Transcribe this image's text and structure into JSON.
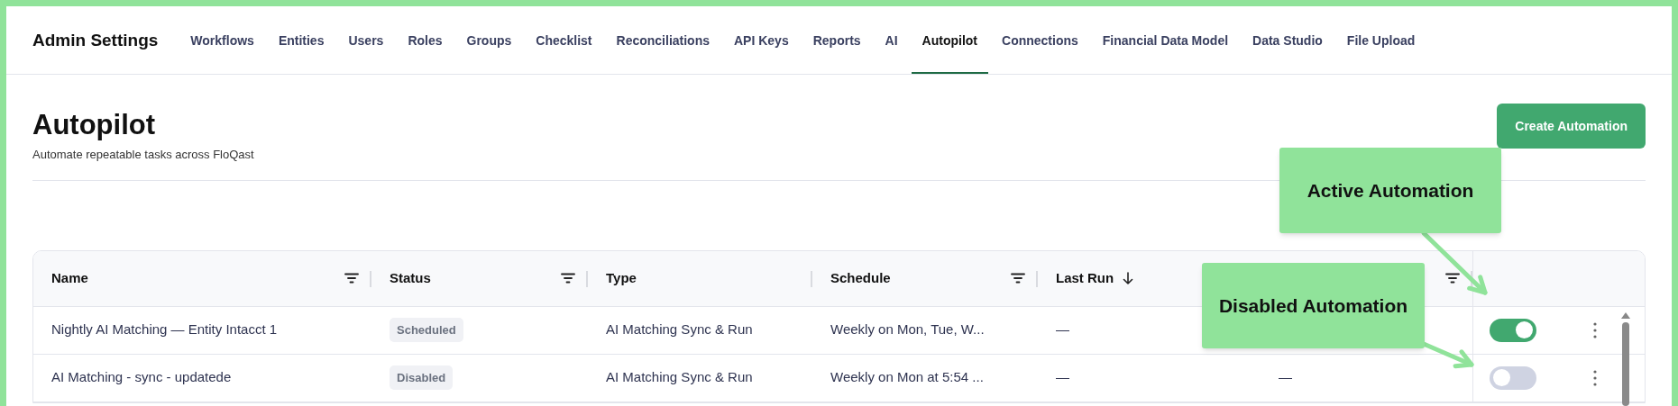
{
  "nav": {
    "title": "Admin Settings",
    "tabs": [
      {
        "label": "Workflows",
        "selected": false
      },
      {
        "label": "Entities",
        "selected": false
      },
      {
        "label": "Users",
        "selected": false
      },
      {
        "label": "Roles",
        "selected": false
      },
      {
        "label": "Groups",
        "selected": false
      },
      {
        "label": "Checklist",
        "selected": false
      },
      {
        "label": "Reconciliations",
        "selected": false
      },
      {
        "label": "API Keys",
        "selected": false
      },
      {
        "label": "Reports",
        "selected": false
      },
      {
        "label": "AI",
        "selected": false
      },
      {
        "label": "Autopilot",
        "selected": true
      },
      {
        "label": "Connections",
        "selected": false
      },
      {
        "label": "Financial Data Model",
        "selected": false
      },
      {
        "label": "Data Studio",
        "selected": false
      },
      {
        "label": "File Upload",
        "selected": false
      }
    ]
  },
  "page": {
    "title": "Autopilot",
    "subtitle": "Automate repeatable tasks across FloQast",
    "create_button": "Create Automation"
  },
  "table": {
    "columns": [
      {
        "label": "Name",
        "kind": "filter"
      },
      {
        "label": "Status",
        "kind": "filter"
      },
      {
        "label": "Type",
        "kind": "plain"
      },
      {
        "label": "Schedule",
        "kind": "filter"
      },
      {
        "label": "Last Run",
        "kind": "sort"
      },
      {
        "kind": "filter"
      }
    ],
    "rows": [
      {
        "name": "Nightly AI Matching — Entity Intacct 1",
        "status": "Scheduled",
        "type": "AI Matching Sync & Run",
        "schedule": "Weekly on Mon, Tue, W...",
        "last_run": "—",
        "on": true
      },
      {
        "name": "AI Matching - sync - updatede",
        "status": "Disabled",
        "type": "AI Matching Sync & Run",
        "schedule": "Weekly on Mon at 5:54 ...",
        "last_run": "—",
        "column_6": "—",
        "on": false
      }
    ]
  },
  "annotations": [
    {
      "text": "Active Automation"
    },
    {
      "text": "Disabled Automation"
    }
  ]
}
